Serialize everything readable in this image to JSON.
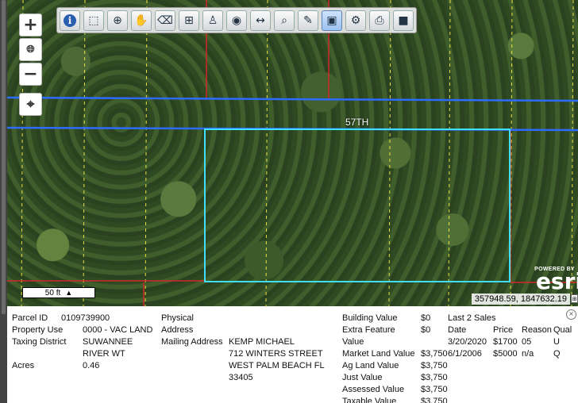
{
  "map": {
    "street_label": "57TH",
    "scale_label": "50 ft",
    "attribution_small": "POWERED BY",
    "attribution_brand": "esri",
    "coordinates": "357948.59, 1847632.19"
  },
  "zoom": {
    "in": "+",
    "globe": "●",
    "out": "−",
    "locate": "⌖"
  },
  "toolbar": [
    {
      "name": "identify-tool",
      "glyph": "i",
      "active": false
    },
    {
      "name": "select-tool",
      "glyph": "⬚",
      "active": false
    },
    {
      "name": "zoom-in-tool",
      "glyph": "⊕",
      "active": false
    },
    {
      "name": "pan-tool",
      "glyph": "✋",
      "active": false
    },
    {
      "name": "eraser-tool",
      "glyph": "⌫",
      "active": false
    },
    {
      "name": "add-tool",
      "glyph": "⊞",
      "active": false
    },
    {
      "name": "person-tool",
      "glyph": "♙",
      "active": false
    },
    {
      "name": "layers-tool",
      "glyph": "◉",
      "active": false
    },
    {
      "name": "measure-tool",
      "glyph": "↔",
      "active": false
    },
    {
      "name": "search-tool",
      "glyph": "⌕",
      "active": false
    },
    {
      "name": "draw-tool",
      "glyph": "✎",
      "active": false
    },
    {
      "name": "map-tool",
      "glyph": "▣",
      "active": true
    },
    {
      "name": "settings-tool",
      "glyph": "⚙",
      "active": false
    },
    {
      "name": "print-tool",
      "glyph": "⎙",
      "active": false
    },
    {
      "name": "save-tool",
      "glyph": "■",
      "active": false
    }
  ],
  "info": {
    "parcel_id_label": "Parcel ID",
    "parcel_id": "0109739900",
    "property_use_label": "Property Use",
    "property_use": "0000 - VAC LAND",
    "taxing_district_label": "Taxing District",
    "taxing_district": "SUWANNEE RIVER WT",
    "acres_label": "Acres",
    "acres": "0.46",
    "physical_address_label": "Physical Address",
    "mailing_address_label": "Mailing Address",
    "mailing_lines": [
      "KEMP MICHAEL",
      "712 WINTERS STREET",
      "WEST PALM BEACH FL",
      "33405"
    ],
    "values": [
      {
        "label": "Building Value",
        "value": "$0"
      },
      {
        "label": "Extra Feature Value",
        "value": "$0"
      },
      {
        "label": "Market Land Value",
        "value": "$3,750"
      },
      {
        "label": "Ag Land Value",
        "value": "$3,750"
      },
      {
        "label": "Just Value",
        "value": "$3,750"
      },
      {
        "label": "Assessed Value",
        "value": "$3,750"
      },
      {
        "label": "Taxable Value",
        "value": "$3,750"
      }
    ],
    "sales_title": "Last 2 Sales",
    "sales_headers": [
      "Date",
      "Price",
      "Reason",
      "Qual"
    ],
    "sales": [
      {
        "date": "3/20/2020",
        "price": "$1700",
        "reason": "05",
        "qual": "U"
      },
      {
        "date": "6/1/2006",
        "price": "$5000",
        "reason": "n/a",
        "qual": "Q"
      }
    ],
    "close": "×"
  }
}
